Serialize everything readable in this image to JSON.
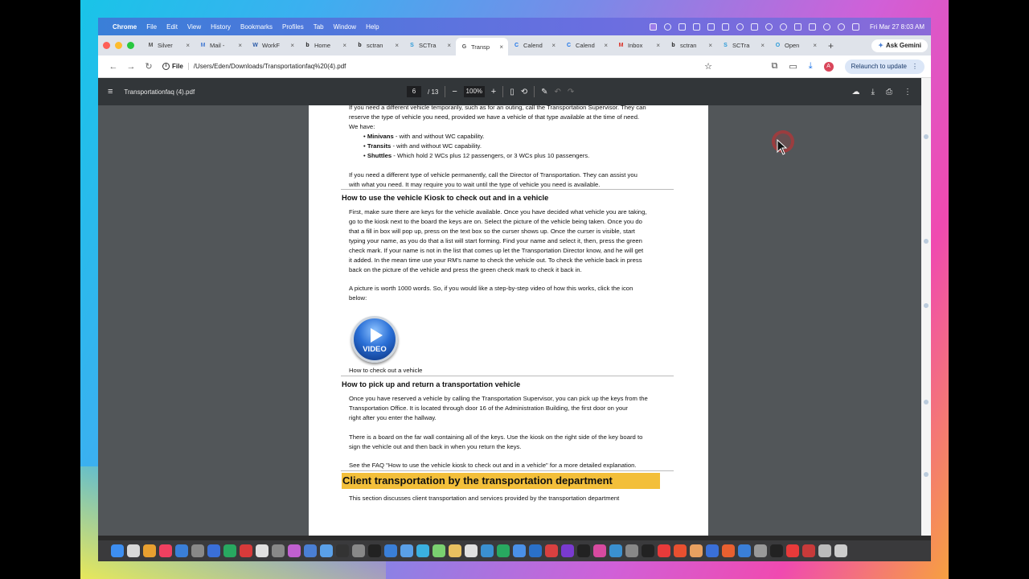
{
  "menubar": {
    "apple_icon": "apple-icon",
    "app": "Chrome",
    "items": [
      "File",
      "Edit",
      "View",
      "History",
      "Bookmarks",
      "Profiles",
      "Tab",
      "Window",
      "Help"
    ],
    "clock": "Fri Mar 27  8:03 AM"
  },
  "tabs": [
    {
      "label": "Silver",
      "fav": "M",
      "color": "#555"
    },
    {
      "label": "Mail -",
      "fav": "M",
      "color": "#4a7fd4"
    },
    {
      "label": "WorkF",
      "fav": "W",
      "color": "#2a5aa8"
    },
    {
      "label": "Home",
      "fav": "b",
      "color": "#1a1a1a"
    },
    {
      "label": "sctran",
      "fav": "b",
      "color": "#1a1a1a"
    },
    {
      "label": "SCTra",
      "fav": "S",
      "color": "#2a9ad8"
    },
    {
      "label": "Transp",
      "fav": "G",
      "color": "#555",
      "active": true
    },
    {
      "label": "Calend",
      "fav": "C",
      "color": "#1a73e8"
    },
    {
      "label": "Calend",
      "fav": "C",
      "color": "#1a73e8"
    },
    {
      "label": "Inbox",
      "fav": "M",
      "color": "#d93025"
    },
    {
      "label": "sctran",
      "fav": "b",
      "color": "#1a1a1a"
    },
    {
      "label": "SCTra",
      "fav": "S",
      "color": "#2a9ad8"
    },
    {
      "label": "Open",
      "fav": "O",
      "color": "#2a9ad8"
    }
  ],
  "gemini_label": "Ask Gemini",
  "toolbar": {
    "chip": "File",
    "url": "/Users/Eden/Downloads/Transportationfaq%20(4).pdf",
    "avatar": "A",
    "relaunch": "Relaunch to update"
  },
  "pdf": {
    "filename": "Transportationfaq (4).pdf",
    "page": "6",
    "total": "/ 13",
    "zoom": "100%"
  },
  "doc": {
    "p1a": "If you need a different vehicle temporarily, such as for an outing, call the Transportation Supervisor. They can",
    "p1b": "reserve the type of vehicle you need, provided we have a vehicle of that type available at the time of need.",
    "p1c": "We have:",
    "b1_bold": "Minivans",
    "b1_rest": " - with and without WC capability.",
    "b2_bold": "Transits",
    "b2_rest": " - with and without WC capability.",
    "b3_bold": "Shuttles",
    "b3_rest": " - Which hold 2 WCs plus 12 passengers, or 3 WCs plus 10 passengers.",
    "p2a": "If you need a different type of vehicle permanently, call the Director of Transportation. They can assist you",
    "p2b": "with what you need. It may require you to wait until the type of vehicle you need is available.",
    "h1": "How to use the vehicle Kiosk to check out and in a vehicle",
    "k1": "First, make sure there are keys for the vehicle available. Once you have decided what vehicle you are taking,",
    "k2": "go to the kiosk next to the board the keys are on. Select the picture of the vehicle being taken. Once you do",
    "k3": "that a fill in box will pop up, press on the text box so the curser shows up. Once the curser is visible, start",
    "k4": "typing your name, as you do that a list will start forming. Find your name and select it, then, press the green",
    "k5": "check mark. If your name is not in the list that comes up let the Transportation Director know, and he will get",
    "k6": "it added. In the mean time use your RM's name to check the vehicle out. To check the vehicle back in press",
    "k7": "back on the picture of the vehicle and press the green check mark to check it back in.",
    "pic1": "A picture is worth 1000 words. So, if you would like a step-by-step video of how this works, click the icon",
    "pic2": "below:",
    "video_label": "VIDEO",
    "caption": "How to check out a vehicle",
    "h2": "How to pick up and return a transportation vehicle",
    "r1": "Once you have reserved a vehicle by calling the Transportation Supervisor, you can pick up the keys from the",
    "r2": "Transportation Office. It is located through door 16 of the Administration Building, the first door on your",
    "r3": "right after you enter the hallway.",
    "s1": "There is a board on the far wall containing all of the keys. Use the kiosk on the right side of the key board to",
    "s2": "sign the vehicle out and then back in when you return the keys.",
    "faq": "See the FAQ \"How to use the vehicle kiosk to check out and in a vehicle\" for a more detailed explanation.",
    "h3": "Client transportation by the transportation department",
    "last": "This section discusses client transportation and services provided by the transportation department"
  },
  "colors": {
    "highlight": "#f3bf3a",
    "menubar": "#5a74e0",
    "relaunch_bg": "#dbe6f7"
  }
}
